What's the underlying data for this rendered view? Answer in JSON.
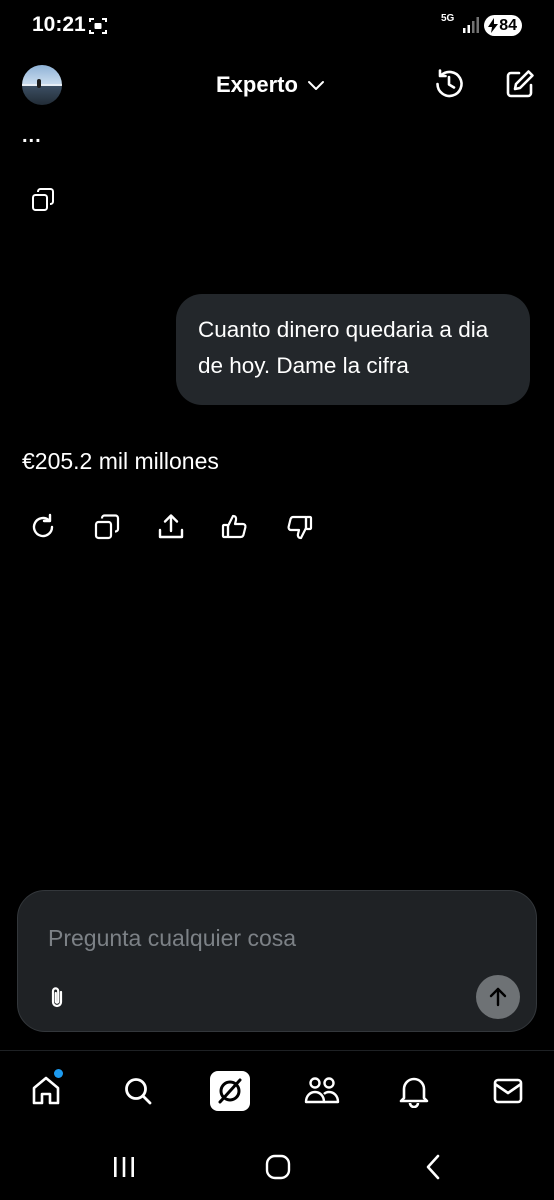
{
  "status_bar": {
    "time": "10:21",
    "network": "5G",
    "battery": "84"
  },
  "header": {
    "mode_label": "Experto",
    "icons": [
      "avatar",
      "chevron-down-icon",
      "history-icon",
      "new-chat-icon"
    ]
  },
  "conversation": {
    "thinking_indicator": "...",
    "user_message": "Cuanto dinero quedaria a dia de hoy. Dame la cifra",
    "assistant_answer": "€205.2 mil millones",
    "answer_actions": [
      "regenerate-icon",
      "copy-icon",
      "share-icon",
      "thumbs-up-icon",
      "thumbs-down-icon"
    ]
  },
  "composer": {
    "placeholder": "Pregunta cualquier cosa",
    "value": ""
  },
  "bottom_nav": {
    "items": [
      "home-icon",
      "search-icon",
      "grok-icon",
      "communities-icon",
      "notifications-icon",
      "messages-icon"
    ],
    "active": "grok",
    "accent_color": "#1d9bf0"
  },
  "colors": {
    "background": "#000000",
    "bubble": "#23272b",
    "composer": "#1f2225",
    "send_button": "#6e7275"
  }
}
